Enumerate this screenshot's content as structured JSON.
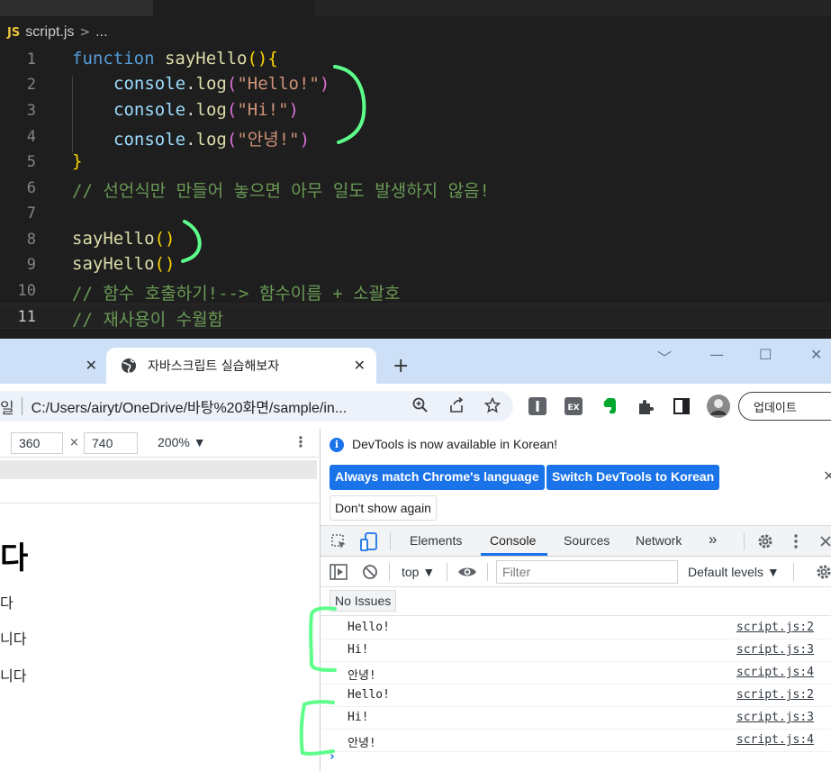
{
  "editor": {
    "file_badge": "JS",
    "breadcrumb_file": "script.js",
    "breadcrumb_sep": ">",
    "breadcrumb_more": "...",
    "line_numbers": [
      "1",
      "2",
      "3",
      "4",
      "5",
      "6",
      "7",
      "8",
      "9",
      "10",
      "11"
    ],
    "code": {
      "l1_kw": "function",
      "l1_fn": "sayHello",
      "l1_paren": "()",
      "l1_brace": "{",
      "obj": "console",
      "dot": ".",
      "method": "log",
      "open": "(",
      "close": ")",
      "s1": "\"Hello!\"",
      "s2": "\"Hi!\"",
      "s3": "\"안녕!\"",
      "l5_brace": "}",
      "l6_comment": "// 선언식만 만들어 놓으면 아무 일도 발생하지 않음!",
      "call_fn": "sayHello",
      "call_paren": "()",
      "l10_comment": "// 함수 호출하기!--> 함수이름 + 소괄호",
      "l11_comment": "// 재사용이 수월함"
    }
  },
  "browser": {
    "prev_tab_close": "✕",
    "active_tab_title": "자바스크립트 실습해보자",
    "active_tab_close": "✕",
    "new_tab": "+",
    "win_controls": [
      "﹀",
      "—",
      "☐",
      "✕"
    ],
    "url_prefix": "일",
    "url": "C:/Users/airyt/OneDrive/바탕%20화면/sample/in...",
    "update_button": "업데이트",
    "ext_ex_label": "EX"
  },
  "viewport": {
    "width": "360",
    "x": "×",
    "height": "740",
    "zoom": "200% ▼",
    "more": "⋮",
    "h1": "다",
    "paragraphs": [
      "다",
      "니다",
      "니다"
    ]
  },
  "devtools": {
    "info_text": "DevTools is now available in Korean!",
    "btn_match": "Always match Chrome's language",
    "btn_switch": "Switch DevTools to Korean",
    "btn_noshow": "Don't show again",
    "info_close": "×",
    "tabs": [
      "Elements",
      "Console",
      "Sources",
      "Network"
    ],
    "more_tabs": "»",
    "context": "top ▼",
    "filter_placeholder": "Filter",
    "levels": "Default levels ▼",
    "issues": "No Issues",
    "logs": [
      {
        "msg": "Hello!",
        "src": "script.js:2"
      },
      {
        "msg": "Hi!",
        "src": "script.js:3"
      },
      {
        "msg": "안녕!",
        "src": "script.js:4"
      },
      {
        "msg": "Hello!",
        "src": "script.js:2"
      },
      {
        "msg": "Hi!",
        "src": "script.js:3"
      },
      {
        "msg": "안녕!",
        "src": "script.js:4"
      }
    ],
    "prompt": "›"
  },
  "colors": {
    "annotation_green": "#5dff8a",
    "keyword": "#569cd6",
    "function": "#dcdcaa",
    "string": "#ce9178",
    "comment": "#6a9955",
    "devtools_blue": "#1a73e8"
  }
}
